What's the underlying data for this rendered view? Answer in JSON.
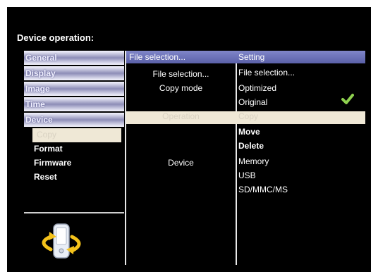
{
  "title": "Device operation:",
  "left_menu": [
    "General",
    "Display",
    "Image",
    "Time",
    "Device"
  ],
  "left_submenu": {
    "selected": "Copy",
    "items": [
      "Format",
      "Firmware",
      "Reset"
    ]
  },
  "middle": {
    "header": "File selection...",
    "items": [
      "File selection...",
      "Copy mode"
    ],
    "selected": "Operation",
    "device_label": "Device"
  },
  "right": {
    "header": "Setting",
    "file_selection": "File selection...",
    "mode_options": [
      "Optimized",
      "Original"
    ],
    "selected_operation": "Copy",
    "operations": [
      "Move",
      "Delete"
    ],
    "devices": [
      "Memory",
      "USB",
      "SD/MMC/MS"
    ]
  },
  "colors": {
    "accent": "#6b72bd",
    "check": "#8fd14f",
    "selection": "#efe8d6"
  }
}
